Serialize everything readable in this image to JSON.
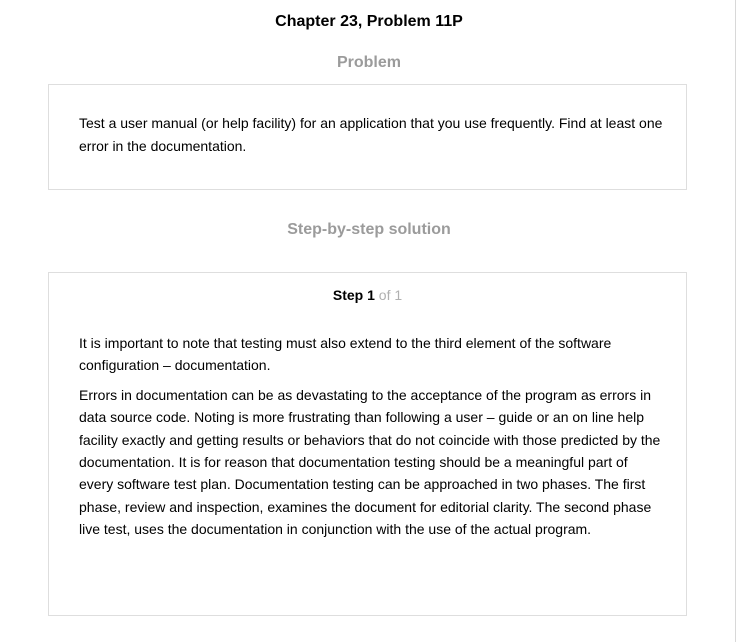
{
  "chapter_title": "Chapter 23, Problem 11P",
  "problem": {
    "heading": "Problem",
    "text": "Test a user manual (or help facility) for an application that you use frequently. Find at least one error in the documentation."
  },
  "solution": {
    "heading": "Step-by-step solution",
    "step": {
      "label": "Step",
      "number": "1",
      "of_text": "of 1"
    },
    "paragraphs": [
      "It is important to note that testing must also extend to the third element of the software configuration – documentation.",
      "Errors in documentation can be as devastating to the acceptance of the program as errors in data source code. Noting is more frustrating than following a user – guide or an on line help facility exactly and getting results or behaviors that do not coincide with those predicted by the documentation. It is for reason that documentation testing should be a meaningful part of every software test plan. Documentation testing can be approached in two phases. The first phase, review and inspection, examines the document for editorial clarity. The second phase live test, uses the documentation in conjunction with the use of the actual program."
    ]
  }
}
